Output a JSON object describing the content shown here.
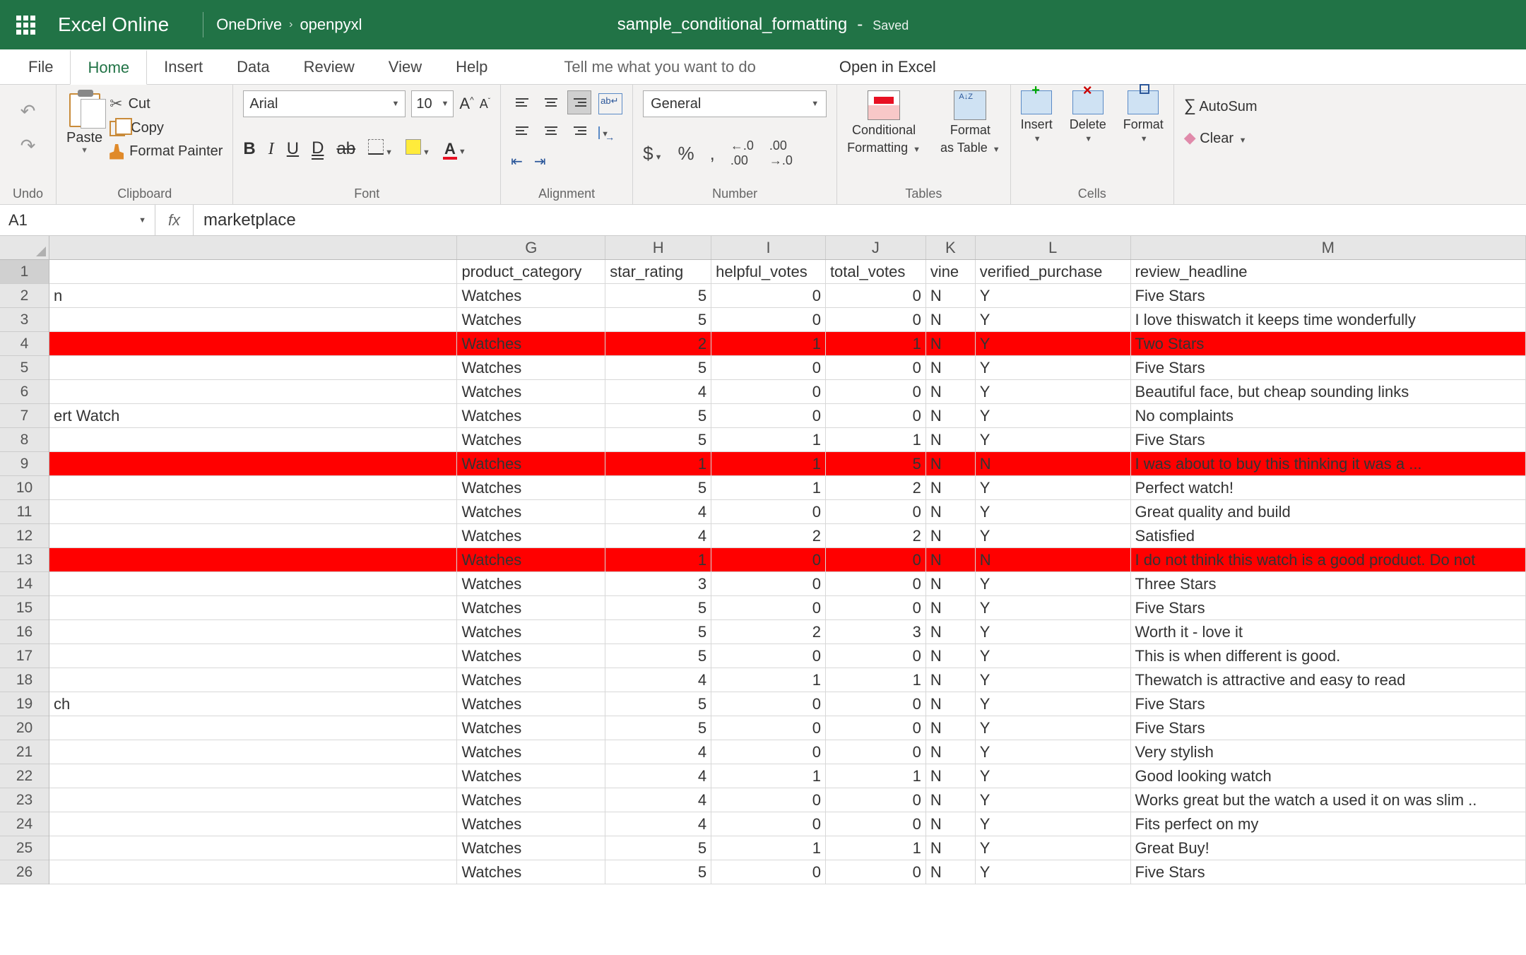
{
  "app": {
    "name": "Excel Online"
  },
  "breadcrumb": {
    "root": "OneDrive",
    "folder": "openpyxl"
  },
  "document": {
    "title": "sample_conditional_formatting",
    "status": "Saved"
  },
  "tabs": {
    "file": "File",
    "home": "Home",
    "insert": "Insert",
    "data": "Data",
    "review": "Review",
    "view": "View",
    "help": "Help",
    "tellme": "Tell me what you want to do",
    "openin": "Open in Excel"
  },
  "ribbon": {
    "undo_label": "Undo",
    "clipboard": {
      "paste": "Paste",
      "cut": "Cut",
      "copy": "Copy",
      "painter": "Format Painter",
      "label": "Clipboard"
    },
    "font": {
      "name": "Arial",
      "size": "10",
      "label": "Font"
    },
    "alignment": {
      "wrap": "ab",
      "label": "Alignment"
    },
    "number": {
      "format": "General",
      "label": "Number"
    },
    "tables": {
      "cf": "Conditional",
      "cf2": "Formatting",
      "fat": "Format",
      "fat2": "as Table",
      "label": "Tables"
    },
    "cells": {
      "insert": "Insert",
      "delete": "Delete",
      "format": "Format",
      "label": "Cells"
    },
    "editing": {
      "autosum": "AutoSum",
      "clear": "Clear"
    }
  },
  "formula": {
    "name_box": "A1",
    "value": "marketplace"
  },
  "columns": [
    {
      "letter": "G",
      "w": "cG"
    },
    {
      "letter": "H",
      "w": "cH"
    },
    {
      "letter": "I",
      "w": "cI"
    },
    {
      "letter": "J",
      "w": "cJ"
    },
    {
      "letter": "K",
      "w": "cK"
    },
    {
      "letter": "L",
      "w": "cL"
    },
    {
      "letter": "M",
      "w": "cM"
    }
  ],
  "headers": {
    "G": "product_category",
    "H": "star_rating",
    "I": "helpful_votes",
    "J": "total_votes",
    "K": "vine",
    "L": "verified_purchase",
    "M": "review_headline"
  },
  "rows": [
    {
      "n": 1,
      "F": "",
      "G": "product_category",
      "H": "star_rating",
      "I": "helpful_votes",
      "J": "total_votes",
      "K": "vine",
      "L": "verified_purchase",
      "M": "review_headline",
      "hdr": true
    },
    {
      "n": 2,
      "F": "n",
      "G": "Watches",
      "H": 5,
      "I": 0,
      "J": 0,
      "K": "N",
      "L": "Y",
      "M": "Five Stars"
    },
    {
      "n": 3,
      "F": "",
      "G": "Watches",
      "H": 5,
      "I": 0,
      "J": 0,
      "K": "N",
      "L": "Y",
      "M": "I love thiswatch it keeps time wonderfully"
    },
    {
      "n": 4,
      "F": "",
      "G": "Watches",
      "H": 2,
      "I": 1,
      "J": 1,
      "K": "N",
      "L": "Y",
      "M": "Two Stars",
      "red": true
    },
    {
      "n": 5,
      "F": "",
      "G": "Watches",
      "H": 5,
      "I": 0,
      "J": 0,
      "K": "N",
      "L": "Y",
      "M": "Five Stars"
    },
    {
      "n": 6,
      "F": "",
      "G": "Watches",
      "H": 4,
      "I": 0,
      "J": 0,
      "K": "N",
      "L": "Y",
      "M": "Beautiful face, but cheap sounding links"
    },
    {
      "n": 7,
      "F": "ert Watch",
      "G": "Watches",
      "H": 5,
      "I": 0,
      "J": 0,
      "K": "N",
      "L": "Y",
      "M": "No complaints"
    },
    {
      "n": 8,
      "F": "",
      "G": "Watches",
      "H": 5,
      "I": 1,
      "J": 1,
      "K": "N",
      "L": "Y",
      "M": "Five Stars"
    },
    {
      "n": 9,
      "F": "",
      "G": "Watches",
      "H": 1,
      "I": 1,
      "J": 5,
      "K": "N",
      "L": "N",
      "M": "I was about to buy this thinking it was a ...",
      "red": true
    },
    {
      "n": 10,
      "F": "",
      "G": "Watches",
      "H": 5,
      "I": 1,
      "J": 2,
      "K": "N",
      "L": "Y",
      "M": "Perfect watch!"
    },
    {
      "n": 11,
      "F": "",
      "G": "Watches",
      "H": 4,
      "I": 0,
      "J": 0,
      "K": "N",
      "L": "Y",
      "M": "Great quality and build"
    },
    {
      "n": 12,
      "F": "",
      "G": "Watches",
      "H": 4,
      "I": 2,
      "J": 2,
      "K": "N",
      "L": "Y",
      "M": "Satisfied"
    },
    {
      "n": 13,
      "F": "",
      "G": "Watches",
      "H": 1,
      "I": 0,
      "J": 0,
      "K": "N",
      "L": "N",
      "M": "I do not think this watch is a good product. Do not",
      "red": true
    },
    {
      "n": 14,
      "F": "",
      "G": "Watches",
      "H": 3,
      "I": 0,
      "J": 0,
      "K": "N",
      "L": "Y",
      "M": "Three Stars"
    },
    {
      "n": 15,
      "F": "",
      "G": "Watches",
      "H": 5,
      "I": 0,
      "J": 0,
      "K": "N",
      "L": "Y",
      "M": "Five Stars"
    },
    {
      "n": 16,
      "F": "",
      "G": "Watches",
      "H": 5,
      "I": 2,
      "J": 3,
      "K": "N",
      "L": "Y",
      "M": "Worth it - love it"
    },
    {
      "n": 17,
      "F": "",
      "G": "Watches",
      "H": 5,
      "I": 0,
      "J": 0,
      "K": "N",
      "L": "Y",
      "M": "This is when different is good."
    },
    {
      "n": 18,
      "F": "",
      "G": "Watches",
      "H": 4,
      "I": 1,
      "J": 1,
      "K": "N",
      "L": "Y",
      "M": "Thewatch is attractive and easy to read"
    },
    {
      "n": 19,
      "F": "ch",
      "G": "Watches",
      "H": 5,
      "I": 0,
      "J": 0,
      "K": "N",
      "L": "Y",
      "M": "Five Stars"
    },
    {
      "n": 20,
      "F": "",
      "G": "Watches",
      "H": 5,
      "I": 0,
      "J": 0,
      "K": "N",
      "L": "Y",
      "M": "Five Stars"
    },
    {
      "n": 21,
      "F": "",
      "G": "Watches",
      "H": 4,
      "I": 0,
      "J": 0,
      "K": "N",
      "L": "Y",
      "M": "Very stylish"
    },
    {
      "n": 22,
      "F": "",
      "G": "Watches",
      "H": 4,
      "I": 1,
      "J": 1,
      "K": "N",
      "L": "Y",
      "M": "Good looking watch"
    },
    {
      "n": 23,
      "F": "",
      "G": "Watches",
      "H": 4,
      "I": 0,
      "J": 0,
      "K": "N",
      "L": "Y",
      "M": "Works great but the watch a used it on was slim .."
    },
    {
      "n": 24,
      "F": "",
      "G": "Watches",
      "H": 4,
      "I": 0,
      "J": 0,
      "K": "N",
      "L": "Y",
      "M": "Fits perfect on my"
    },
    {
      "n": 25,
      "F": "",
      "G": "Watches",
      "H": 5,
      "I": 1,
      "J": 1,
      "K": "N",
      "L": "Y",
      "M": "Great Buy!"
    },
    {
      "n": 26,
      "F": "",
      "G": "Watches",
      "H": 5,
      "I": 0,
      "J": 0,
      "K": "N",
      "L": "Y",
      "M": "Five Stars"
    }
  ]
}
